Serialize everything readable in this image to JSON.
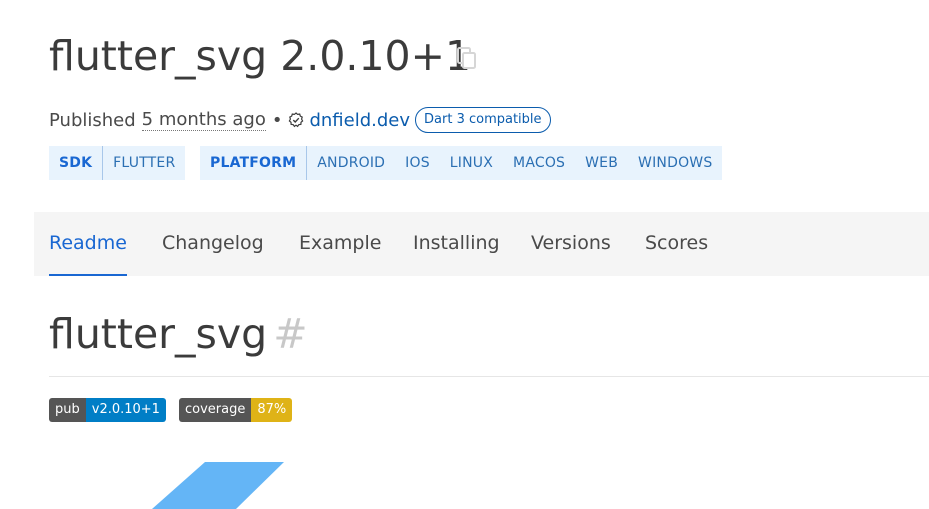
{
  "package": {
    "title": "flutter_svg 2.0.10+1",
    "published_prefix": "Published",
    "published_ago": "5 months ago",
    "separator": "•",
    "publisher": "dnfield.dev",
    "dart_badge": "Dart 3 compatible"
  },
  "tags": {
    "sdk": {
      "head": "SDK",
      "items": [
        "FLUTTER"
      ]
    },
    "platform": {
      "head": "PLATFORM",
      "items": [
        "ANDROID",
        "IOS",
        "LINUX",
        "MACOS",
        "WEB",
        "WINDOWS"
      ]
    }
  },
  "tabs": [
    "Readme",
    "Changelog",
    "Example",
    "Installing",
    "Versions",
    "Scores"
  ],
  "active_tab": "Readme",
  "readme": {
    "heading": "flutter_svg",
    "anchor": "#",
    "badges": [
      {
        "label": "pub",
        "value": "v2.0.10+1",
        "color": "#007ec6"
      },
      {
        "label": "coverage",
        "value": "87%",
        "color": "#dfb317"
      }
    ]
  },
  "colors": {
    "link": "#0b5cad",
    "active_tab": "#1967d2",
    "tag_bg": "#e8f3fd",
    "logo": "#64b5f6"
  },
  "icons": [
    "copy-icon",
    "verified-publisher-icon",
    "flutter-svg-logo"
  ]
}
